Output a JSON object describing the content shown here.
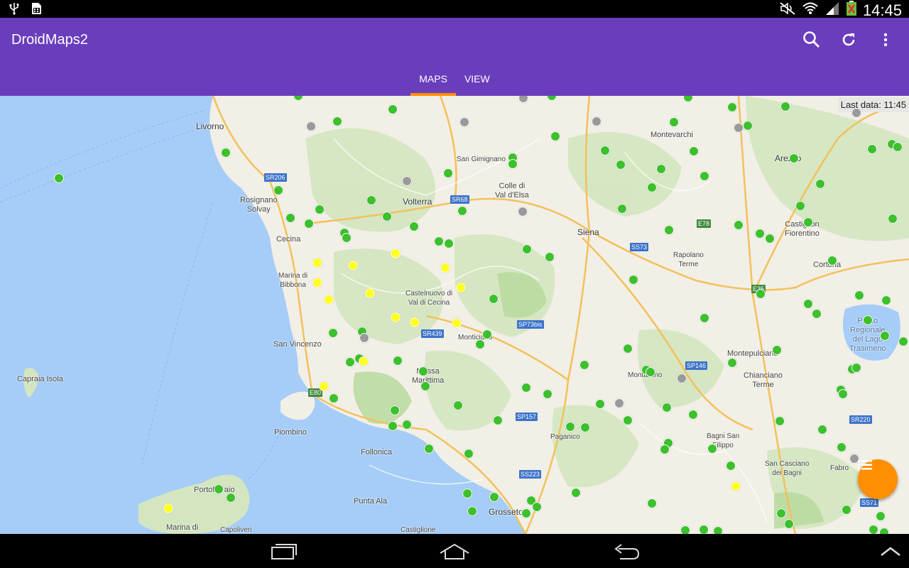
{
  "status_bar": {
    "time": "14:45",
    "left_icons": [
      "usb-icon",
      "sim-icon"
    ],
    "right_icons": [
      "mute-icon",
      "wifi-icon",
      "signal-icon",
      "battery-icon"
    ]
  },
  "app_bar": {
    "title": "DroidMaps2",
    "actions": [
      "search-icon",
      "refresh-icon",
      "overflow-menu-icon"
    ],
    "tabs": [
      {
        "label": "MAPS",
        "active": true
      },
      {
        "label": "VIEW",
        "active": false
      }
    ],
    "color": "#6a3dbd",
    "accent": "#ff8f00"
  },
  "map": {
    "last_data": "Last data: 11:45",
    "places": {
      "livorno": "Livorno",
      "rosignano": "Rosignano\nSolvay",
      "cecina": "Cecina",
      "marina_bibbona": "Marina di\nBibbona",
      "san_vincenzo": "San Vincenzo",
      "capraia": "Capraia Isola",
      "piombino": "Piombino",
      "follonica": "Follonica",
      "portoferraio": "Portoferraio",
      "marina_di": "Marina di",
      "capoliveri": "Capoliveri",
      "punta_ala": "Punta Ala",
      "castiglione": "Castiglione",
      "grosseto": "Grosseto",
      "volterra": "Volterra",
      "san_gimignano": "San Gimignano",
      "colle": "Colle di\nVal d'Elsa",
      "siena": "Siena",
      "montevarchi": "Montevarchi",
      "arezzo": "Arezzo",
      "castiglion_fiorentino": "Castiglion\nFiorentino",
      "rapolano": "Rapolano\nTerme",
      "cortona": "Cortona",
      "parco": "Parco\nRegionale\ndel Lago\nTrasimeno",
      "castelnuovo": "Castelnuovo di\nVal di Cecina",
      "monticiano": "Monticiano",
      "massa": "Massa\nMarittima",
      "montalcino": "Montalcino",
      "montepulciano": "Montepulciano",
      "chianciano": "Chianciano\nTerme",
      "paganico": "Paganico",
      "bagni": "Bagni San\nFilippo",
      "san_casciano": "San Casciano\ndei Bagni",
      "fabro": "Fabro"
    },
    "roads": {
      "sr206": "SR206",
      "sr68": "SR68",
      "e78": "E78",
      "ss73": "SS73",
      "e35": "E35",
      "sr439": "SR439",
      "sp73bis": "SP73bis",
      "e80": "E80",
      "sp146": "SP146",
      "sp157": "SP157",
      "ss223": "SS223",
      "sr220": "SR220",
      "ss71": "SS71"
    },
    "marker_colors": {
      "green": "#3cc02c",
      "yellow": "#ffff22",
      "gray": "#9a9a9a"
    }
  },
  "fab": {
    "icon": "list-icon",
    "color": "#ff8f00"
  },
  "nav_bar": {
    "buttons": [
      "recent-apps-icon",
      "home-icon",
      "back-icon",
      "collapse-icon"
    ]
  }
}
